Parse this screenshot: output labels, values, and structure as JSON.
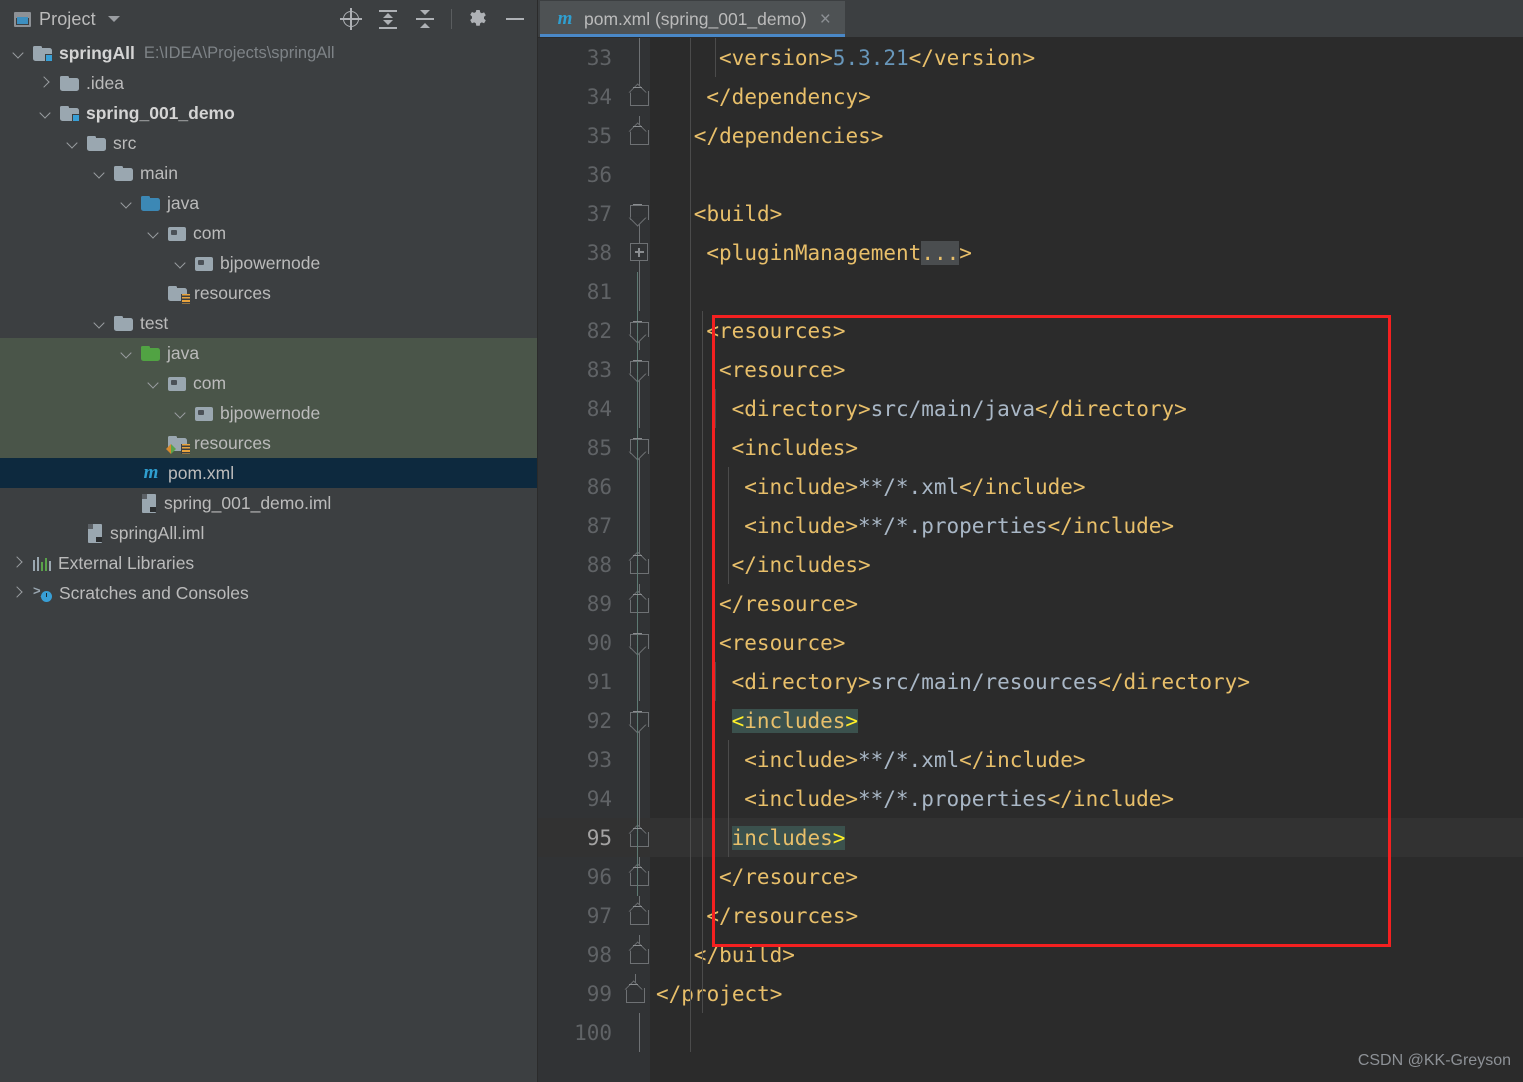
{
  "toolwindow": {
    "title": "Project",
    "icons": [
      "project-panel-icon",
      "chevron-down-icon",
      "locate-icon",
      "expand-all-icon",
      "collapse-all-icon",
      "gear-icon",
      "minimize-icon"
    ]
  },
  "tree": [
    {
      "label": "springAll",
      "path": "E:\\IDEA\\Projects\\springAll",
      "indent": 0,
      "arrow": "open",
      "icon": "module-folder",
      "bold": true,
      "state": "normal"
    },
    {
      "label": ".idea",
      "path": "",
      "indent": 1,
      "arrow": "closed",
      "icon": "folder",
      "bold": false,
      "state": "normal"
    },
    {
      "label": "spring_001_demo",
      "path": "",
      "indent": 1,
      "arrow": "open",
      "icon": "module-folder",
      "bold": true,
      "state": "normal"
    },
    {
      "label": "src",
      "path": "",
      "indent": 2,
      "arrow": "open",
      "icon": "folder",
      "bold": false,
      "state": "normal"
    },
    {
      "label": "main",
      "path": "",
      "indent": 3,
      "arrow": "open",
      "icon": "folder",
      "bold": false,
      "state": "normal"
    },
    {
      "label": "java",
      "path": "",
      "indent": 4,
      "arrow": "open",
      "icon": "source-folder-blue",
      "bold": false,
      "state": "normal"
    },
    {
      "label": "com",
      "path": "",
      "indent": 5,
      "arrow": "open",
      "icon": "package",
      "bold": false,
      "state": "normal"
    },
    {
      "label": "bjpowernode",
      "path": "",
      "indent": 6,
      "arrow": "open",
      "icon": "package",
      "bold": false,
      "state": "normal"
    },
    {
      "label": "resources",
      "path": "",
      "indent": 5,
      "arrow": "none",
      "icon": "resources-folder",
      "bold": false,
      "state": "normal"
    },
    {
      "label": "test",
      "path": "",
      "indent": 3,
      "arrow": "open",
      "icon": "folder",
      "bold": false,
      "state": "normal"
    },
    {
      "label": "java",
      "path": "",
      "indent": 4,
      "arrow": "open",
      "icon": "source-folder-green",
      "bold": false,
      "state": "highlight"
    },
    {
      "label": "com",
      "path": "",
      "indent": 5,
      "arrow": "open",
      "icon": "package",
      "bold": false,
      "state": "highlight"
    },
    {
      "label": "bjpowernode",
      "path": "",
      "indent": 6,
      "arrow": "open",
      "icon": "package",
      "bold": false,
      "state": "highlight"
    },
    {
      "label": "resources",
      "path": "",
      "indent": 5,
      "arrow": "none",
      "icon": "test-resources-folder",
      "bold": false,
      "state": "highlight"
    },
    {
      "label": "pom.xml",
      "path": "",
      "indent": 4,
      "arrow": "none",
      "icon": "maven",
      "bold": false,
      "state": "selected"
    },
    {
      "label": "spring_001_demo.iml",
      "path": "",
      "indent": 4,
      "arrow": "none",
      "icon": "iml",
      "bold": false,
      "state": "normal"
    },
    {
      "label": "springAll.iml",
      "path": "",
      "indent": 2,
      "arrow": "none",
      "icon": "iml",
      "bold": false,
      "state": "normal"
    },
    {
      "label": "External Libraries",
      "path": "",
      "indent": 0,
      "arrow": "closed",
      "icon": "libraries",
      "bold": false,
      "state": "normal"
    },
    {
      "label": "Scratches and Consoles",
      "path": "",
      "indent": 0,
      "arrow": "closed",
      "icon": "scratches",
      "bold": false,
      "state": "normal"
    }
  ],
  "editor": {
    "tab": {
      "label": "pom.xml (spring_001_demo)",
      "icon": "maven-icon",
      "close": "×"
    },
    "current_line": 95,
    "lines": [
      {
        "no": "33",
        "fold": "stem",
        "indent": 5,
        "segs": [
          {
            "c": "t",
            "s": "<version>"
          },
          {
            "c": "n",
            "s": "5.3.21"
          },
          {
            "c": "t",
            "s": "</version>"
          }
        ]
      },
      {
        "no": "34",
        "fold": "up",
        "indent": 4,
        "segs": [
          {
            "c": "t",
            "s": "</dependency>"
          }
        ]
      },
      {
        "no": "35",
        "fold": "up",
        "indent": 3,
        "segs": [
          {
            "c": "t",
            "s": "</dependencies>"
          }
        ]
      },
      {
        "no": "36",
        "fold": "none",
        "indent": 0,
        "segs": [
          {
            "c": "v",
            "s": ""
          }
        ]
      },
      {
        "no": "37",
        "fold": "dn",
        "indent": 3,
        "segs": [
          {
            "c": "t",
            "s": "<build>"
          }
        ]
      },
      {
        "no": "38",
        "fold": "plus",
        "indent": 4,
        "segs": [
          {
            "c": "t",
            "s": "<pluginManagement"
          },
          {
            "c": "fold",
            "s": "..."
          },
          {
            "c": "t",
            "s": ">"
          }
        ]
      },
      {
        "no": "81",
        "fold": "stem",
        "indent": 0,
        "segs": [
          {
            "c": "v",
            "s": ""
          }
        ]
      },
      {
        "no": "82",
        "fold": "dn",
        "indent": 4,
        "segs": [
          {
            "c": "t",
            "s": "<resources>"
          }
        ]
      },
      {
        "no": "83",
        "fold": "dn",
        "indent": 5,
        "segs": [
          {
            "c": "t",
            "s": "<resource>"
          }
        ]
      },
      {
        "no": "84",
        "fold": "stem",
        "indent": 6,
        "segs": [
          {
            "c": "t",
            "s": "<directory>"
          },
          {
            "c": "v",
            "s": "src/main/java"
          },
          {
            "c": "t",
            "s": "</directory>"
          }
        ]
      },
      {
        "no": "85",
        "fold": "dn",
        "indent": 6,
        "segs": [
          {
            "c": "t",
            "s": "<includes>"
          }
        ]
      },
      {
        "no": "86",
        "fold": "stem",
        "indent": 7,
        "segs": [
          {
            "c": "t",
            "s": "<include>"
          },
          {
            "c": "v",
            "s": "**/*.xml"
          },
          {
            "c": "t",
            "s": "</include>"
          }
        ]
      },
      {
        "no": "87",
        "fold": "stem",
        "indent": 7,
        "segs": [
          {
            "c": "t",
            "s": "<include>"
          },
          {
            "c": "v",
            "s": "**/*.properties"
          },
          {
            "c": "t",
            "s": "</include>"
          }
        ]
      },
      {
        "no": "88",
        "fold": "up",
        "indent": 6,
        "segs": [
          {
            "c": "t",
            "s": "</includes>"
          }
        ]
      },
      {
        "no": "89",
        "fold": "up",
        "indent": 5,
        "segs": [
          {
            "c": "t",
            "s": "</resource>"
          }
        ]
      },
      {
        "no": "90",
        "fold": "dn",
        "indent": 5,
        "segs": [
          {
            "c": "t",
            "s": "<resource>"
          }
        ]
      },
      {
        "no": "91",
        "fold": "stem",
        "indent": 6,
        "segs": [
          {
            "c": "t",
            "s": "<directory>"
          },
          {
            "c": "v",
            "s": "src/main/resources"
          },
          {
            "c": "t",
            "s": "</directory>"
          }
        ]
      },
      {
        "no": "92",
        "fold": "dn",
        "indent": 6,
        "segs": [
          {
            "c": "hl",
            "s": "<includes>"
          }
        ]
      },
      {
        "no": "93",
        "fold": "stem",
        "indent": 7,
        "segs": [
          {
            "c": "t",
            "s": "<include>"
          },
          {
            "c": "v",
            "s": "**/*.xml"
          },
          {
            "c": "t",
            "s": "</include>"
          }
        ]
      },
      {
        "no": "94",
        "fold": "stem",
        "indent": 7,
        "segs": [
          {
            "c": "t",
            "s": "<include>"
          },
          {
            "c": "v",
            "s": "**/*.properties"
          },
          {
            "c": "t",
            "s": "</include>"
          }
        ]
      },
      {
        "no": "95",
        "fold": "up",
        "indent": 6,
        "segs": [
          {
            "c": "hl",
            "s": "</includes>"
          }
        ]
      },
      {
        "no": "96",
        "fold": "up",
        "indent": 5,
        "segs": [
          {
            "c": "t",
            "s": "</resource>"
          }
        ]
      },
      {
        "no": "97",
        "fold": "up",
        "indent": 4,
        "segs": [
          {
            "c": "t",
            "s": "</resources>"
          }
        ]
      },
      {
        "no": "98",
        "fold": "up",
        "indent": 3,
        "segs": [
          {
            "c": "t",
            "s": "</build>"
          }
        ]
      },
      {
        "no": "99",
        "fold": "up-root",
        "indent": 0,
        "segs": [
          {
            "c": "t",
            "s": "</project>"
          }
        ]
      },
      {
        "no": "100",
        "fold": "stem",
        "indent": 0,
        "segs": [
          {
            "c": "v",
            "s": ""
          }
        ]
      }
    ]
  },
  "annotation": {
    "type": "red-rectangle",
    "color": "#f42020"
  },
  "watermark": "CSDN @KK-Greyson",
  "colors": {
    "tag": "#e8bf6a",
    "value": "#a9b7c6",
    "number": "#6897bb",
    "editor_bg": "#2b2b2b",
    "gutter_bg": "#313335",
    "panel_bg": "#3c3f41",
    "selection": "#0d293e",
    "highlight_green": "#4a5549",
    "match_brace": "#3b514d",
    "accent": "#4a88c7"
  }
}
